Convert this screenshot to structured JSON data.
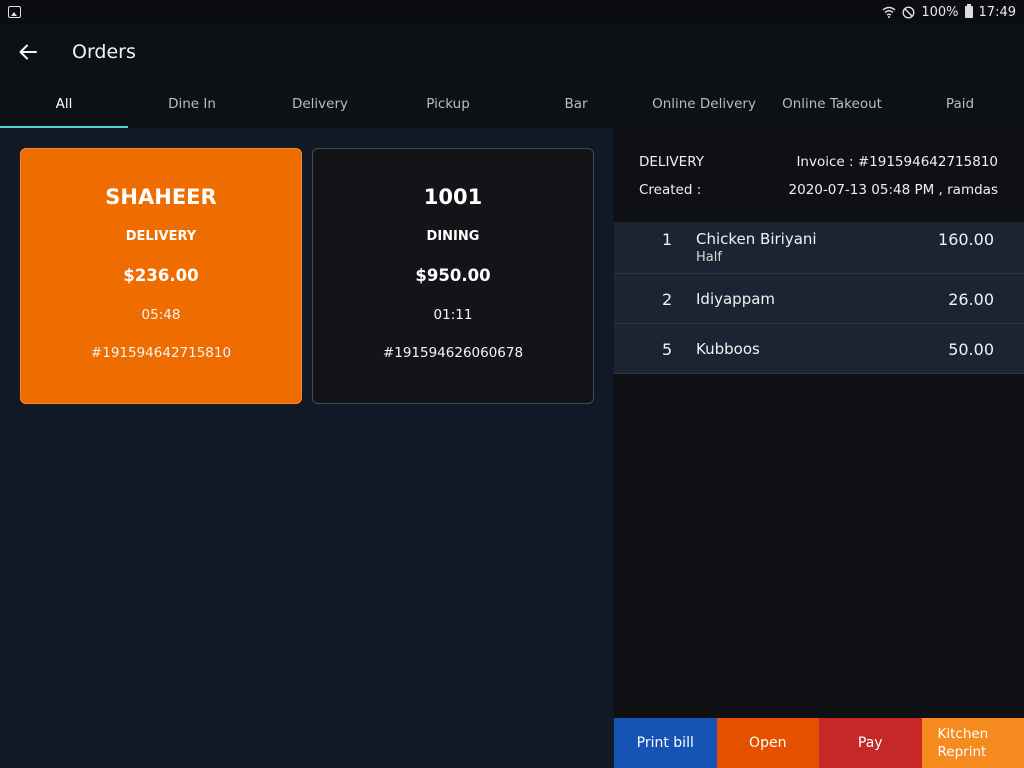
{
  "status_bar": {
    "battery": "100%",
    "time": "17:49"
  },
  "app_bar": {
    "title": "Orders"
  },
  "tabs": [
    {
      "label": "All"
    },
    {
      "label": "Dine In"
    },
    {
      "label": "Delivery"
    },
    {
      "label": "Pickup"
    },
    {
      "label": "Bar"
    },
    {
      "label": "Online Delivery"
    },
    {
      "label": "Online Takeout"
    },
    {
      "label": "Paid"
    }
  ],
  "orders": [
    {
      "name": "SHAHEER",
      "type": "DELIVERY",
      "amount": "$236.00",
      "time": "05:48",
      "invoice": "#191594642715810"
    },
    {
      "name": "1001",
      "type": "DINING",
      "amount": "$950.00",
      "time": "01:11",
      "invoice": "#191594626060678"
    }
  ],
  "detail": {
    "order_type": "DELIVERY",
    "invoice_label": "Invoice : #191594642715810",
    "created_label": "Created :",
    "created_value": "2020-07-13  05:48 PM , ramdas",
    "items": [
      {
        "qty": "1",
        "name": "Chicken Biriyani",
        "note": "Half",
        "price": "160.00"
      },
      {
        "qty": "2",
        "name": "Idiyappam",
        "note": "",
        "price": "26.00"
      },
      {
        "qty": "5",
        "name": "Kubboos",
        "note": "",
        "price": "50.00"
      }
    ]
  },
  "actions": {
    "print_bill": "Print bill",
    "open": "Open",
    "pay": "Pay",
    "kitchen_line1": "Kitchen",
    "kitchen_line2": "Reprint"
  },
  "colors": {
    "accent_tab": "#4fd6cf",
    "selected_card": "#ef6c00",
    "print_bill": "#1553b4",
    "open": "#e65100",
    "pay": "#c62828",
    "kitchen_reprint": "#f58a1f"
  }
}
